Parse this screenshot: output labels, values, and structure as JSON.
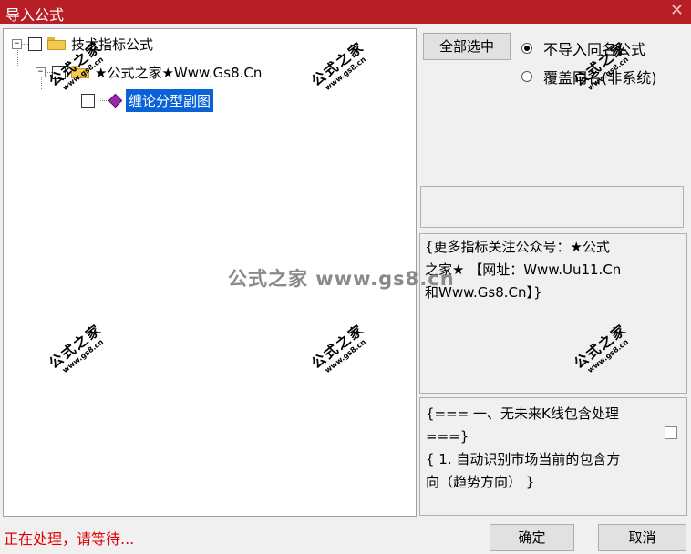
{
  "window": {
    "title": "导入公式",
    "close_symbol": "✕"
  },
  "tree": {
    "root": {
      "expander": "−",
      "label": "技术指标公式"
    },
    "child": {
      "expander": "−",
      "label": "★公式之家★Www.Gs8.Cn"
    },
    "leaf": {
      "label": "缠论分型副图"
    }
  },
  "options": {
    "select_all_label": "全部选中",
    "radio_no_import": "不导入同名公式",
    "radio_overwrite": "覆盖同名(非系统)"
  },
  "info_text": {
    "line1": "{更多指标关注公众号：★公式",
    "line2": "之家★ 【网址：Www.Uu11.Cn",
    "line3": "和Www.Gs8.Cn】}"
  },
  "formula_preview": {
    "line1": "{=== 一、无未来K线包含处理",
    "line2": "===}",
    "line3": "{ 1. 自动识别市场当前的包含方",
    "line4": "向（趋势方向） }"
  },
  "status_text": "正在处理，请等待...",
  "buttons": {
    "ok": "确定",
    "cancel": "取消"
  },
  "watermark": {
    "cn": "公式之家",
    "url": "www.gs8.cn",
    "center": "公式之家 www.gs8.cn"
  },
  "colors": {
    "titlebar": "#b81e26",
    "selection": "#0a62d8",
    "status": "#e00000"
  }
}
